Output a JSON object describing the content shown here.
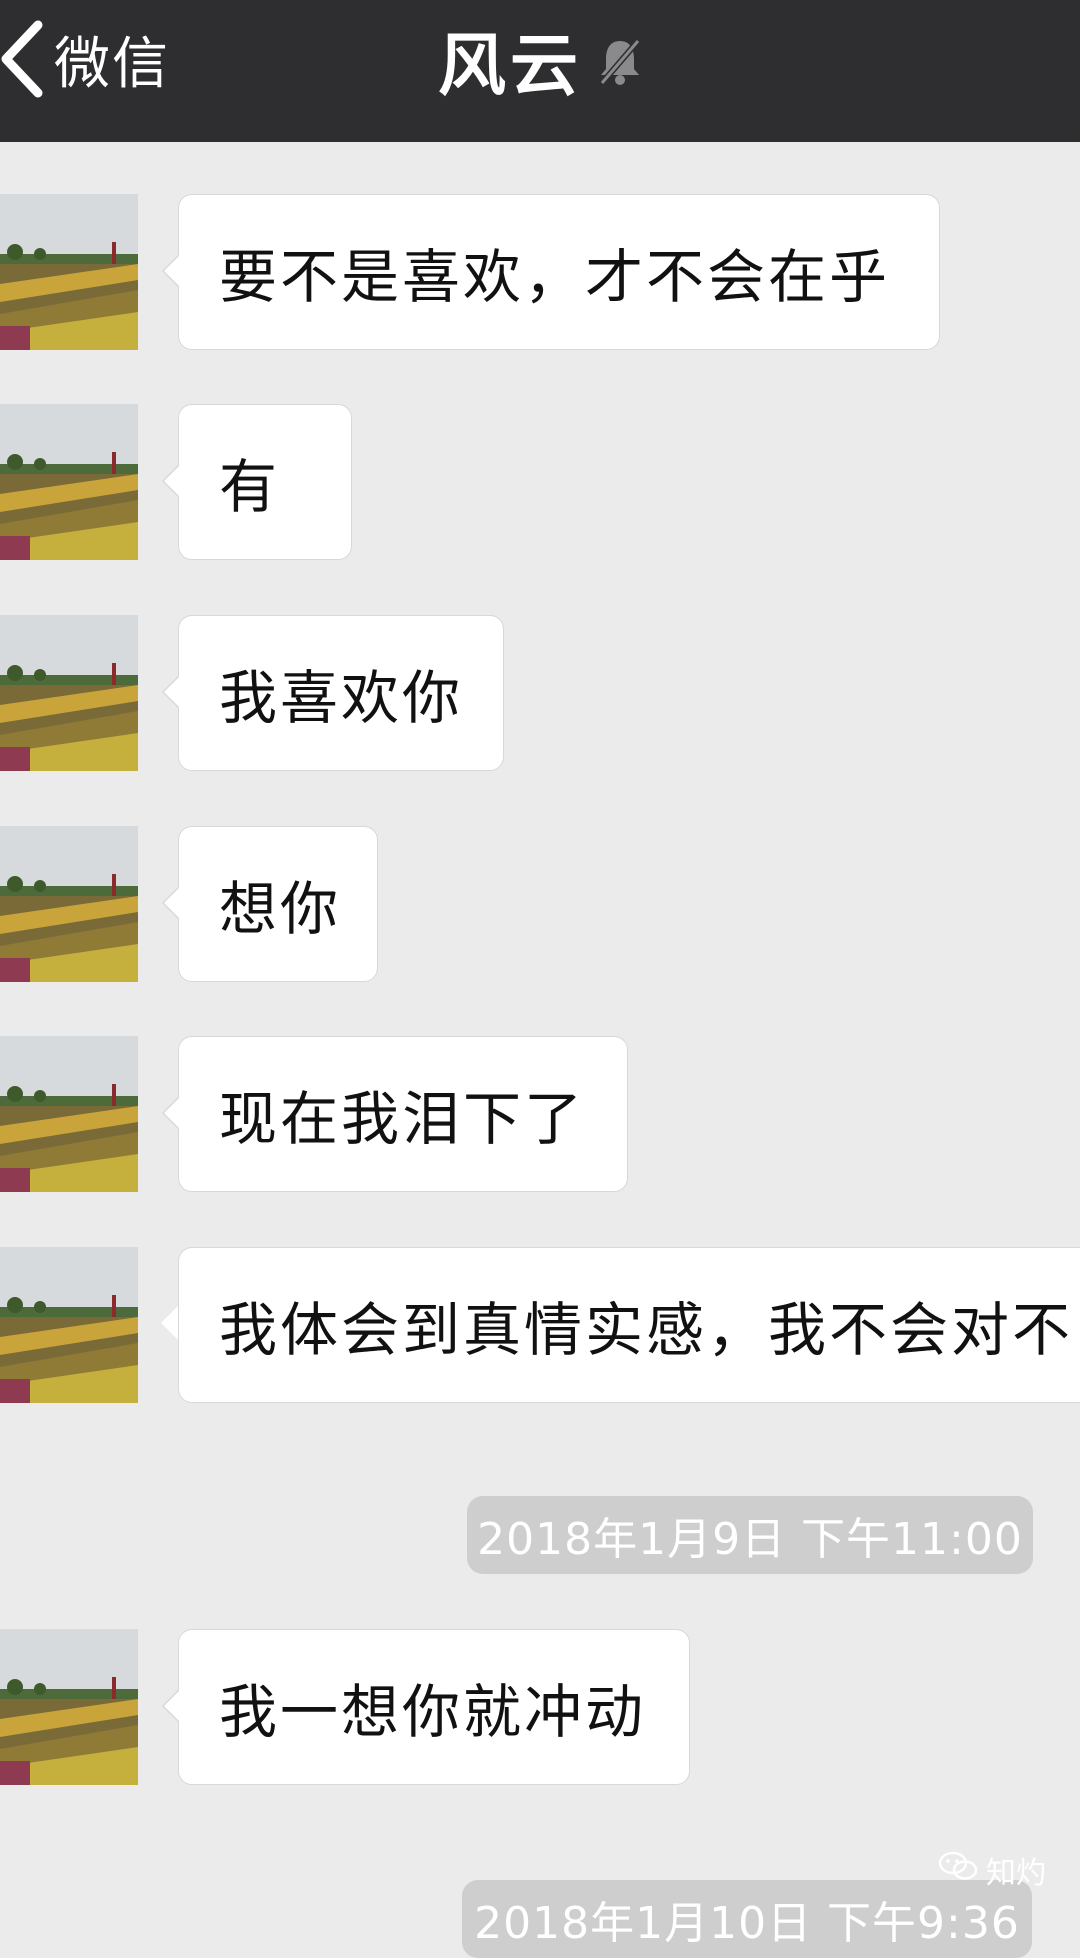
{
  "navbar": {
    "back_label": "微信",
    "title": "风云",
    "mute_icon": "bell-slash-icon"
  },
  "messages": [
    {
      "text": "要不是喜欢，才不会在乎"
    },
    {
      "text": "有"
    },
    {
      "text": "我喜欢你"
    },
    {
      "text": "想你"
    },
    {
      "text": "现在我泪下了"
    },
    {
      "text": "我体会到真情实感，我不会对不"
    },
    {
      "text": "我一想你就冲动"
    }
  ],
  "timestamps": [
    {
      "text": "2018年1月9日 下午11:00"
    },
    {
      "text": "2018年1月10日 下午9:36"
    }
  ],
  "watermark": {
    "text": "知灼",
    "icon": "wechat-icon"
  },
  "colors": {
    "navbar_bg": "#2e2e30",
    "chat_bg": "#ebebeb",
    "bubble_bg": "#ffffff",
    "timestamp_bg": "#cecece"
  }
}
